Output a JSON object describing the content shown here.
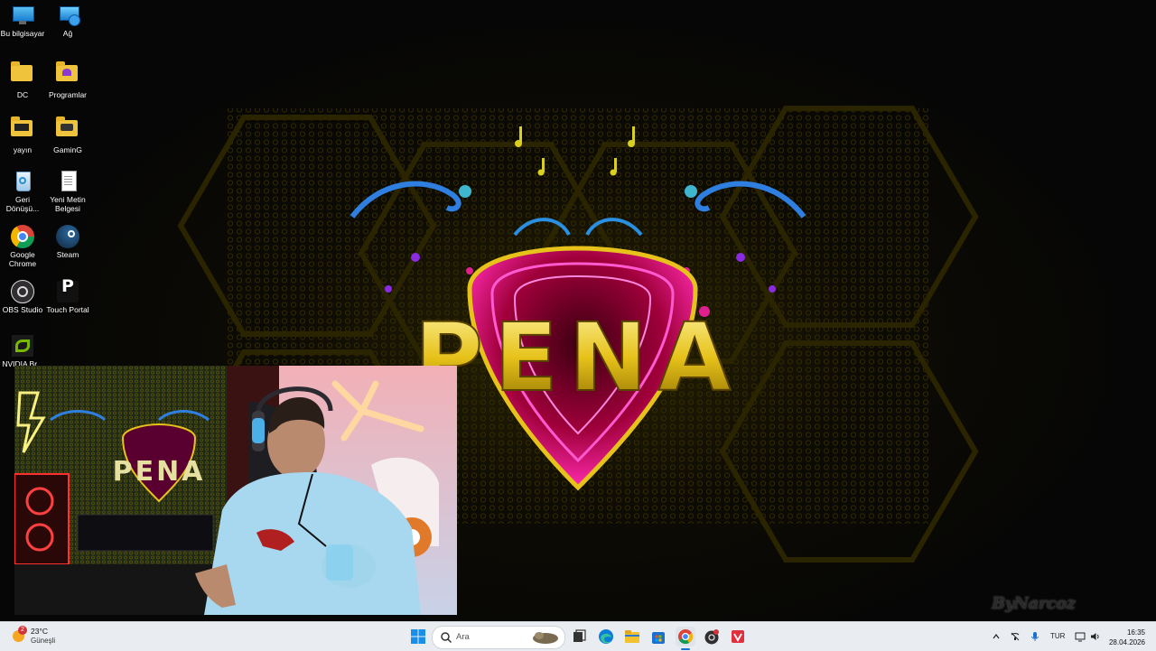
{
  "desktop": {
    "icons": [
      {
        "label": "Bu bilgisayar",
        "icon": "computer-icon"
      },
      {
        "label": "Ağ",
        "icon": "network-icon"
      },
      {
        "label": "DC",
        "icon": "folder-icon"
      },
      {
        "label": "Programlar",
        "icon": "folder-icon"
      },
      {
        "label": "yayın",
        "icon": "folder-icon"
      },
      {
        "label": "GaminG",
        "icon": "folder-icon"
      },
      {
        "label": "Geri Dönüşü...",
        "icon": "recycle-bin-icon"
      },
      {
        "label": "Yeni Metin Belgesi",
        "icon": "text-document-icon"
      },
      {
        "label": "Google Chrome",
        "icon": "chrome-icon"
      },
      {
        "label": "Steam",
        "icon": "steam-icon"
      },
      {
        "label": "OBS Studio",
        "icon": "obs-icon"
      },
      {
        "label": "Touch Portal",
        "icon": "touch-portal-icon"
      },
      {
        "label": "NVIDIA Br...",
        "icon": "nvidia-icon"
      }
    ],
    "wallpaper_logo": "PENA",
    "watermark": "ByNarcoz"
  },
  "taskbar": {
    "weather": {
      "badge": "2",
      "temp": "23°C",
      "condition": "Güneşli"
    },
    "search_placeholder": "Ara",
    "apps": [
      "start-icon",
      "search-icon",
      "task-view-icon",
      "edge-icon",
      "file-explorer-icon",
      "store-icon",
      "chrome-icon",
      "obs-icon",
      "app-red-icon"
    ],
    "tray": {
      "language": "TUR"
    },
    "clock": {
      "time": "16:35",
      "date": "28.04.2026"
    }
  },
  "colors": {
    "taskbar_bg": "#e9edf2",
    "logo_gold": "#e6c21a",
    "logo_magenta": "#d81fa0",
    "hex_yellow": "#6a5a00"
  }
}
